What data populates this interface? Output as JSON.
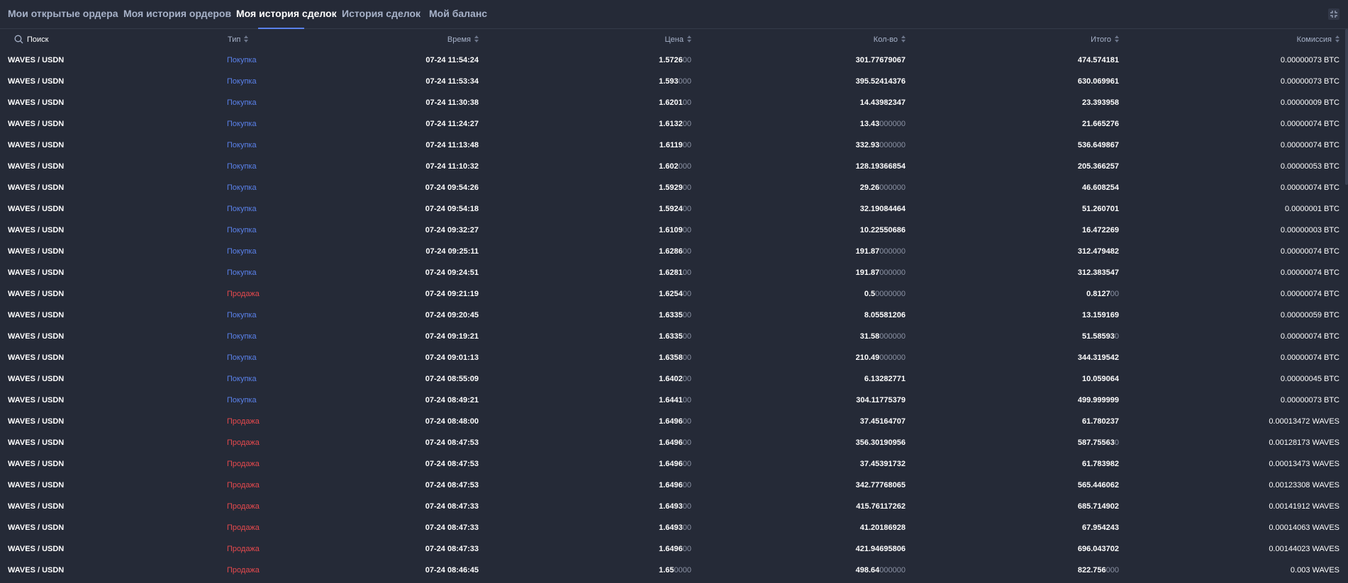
{
  "tabs": [
    {
      "label": "Мои открытые ордера"
    },
    {
      "label": "Моя история ордеров"
    },
    {
      "label": "Моя история сделок"
    },
    {
      "label": "История сделок"
    },
    {
      "label": "Мой баланс"
    }
  ],
  "active_tab": "Моя история сделок",
  "search": {
    "placeholder": "Поиск",
    "value": ""
  },
  "columns": {
    "type": "Тип",
    "time": "Время",
    "price": "Цена",
    "qty": "Кол-во",
    "total": "Итого",
    "fee": "Комиссия"
  },
  "colors": {
    "background": "#252a37",
    "buy": "#5a81ea",
    "sell": "#e5494d",
    "muted_digits": "#8c93a5",
    "tab_inactive": "#a7b2c9"
  },
  "rows": [
    {
      "pair": "WAVES / USDN",
      "type": "Покупка",
      "side": "buy",
      "time": "07-24 11:54:24",
      "price": "1.5726",
      "price_pad": "00",
      "qty": "301.77679067",
      "qty_pad": "",
      "total": "474.574181",
      "total_pad": "",
      "fee": "0.00000073 BTC"
    },
    {
      "pair": "WAVES / USDN",
      "type": "Покупка",
      "side": "buy",
      "time": "07-24 11:53:34",
      "price": "1.593",
      "price_pad": "000",
      "qty": "395.52414376",
      "qty_pad": "",
      "total": "630.069961",
      "total_pad": "",
      "fee": "0.00000073 BTC"
    },
    {
      "pair": "WAVES / USDN",
      "type": "Покупка",
      "side": "buy",
      "time": "07-24 11:30:38",
      "price": "1.6201",
      "price_pad": "00",
      "qty": "14.43982347",
      "qty_pad": "",
      "total": "23.393958",
      "total_pad": "",
      "fee": "0.00000009 BTC"
    },
    {
      "pair": "WAVES / USDN",
      "type": "Покупка",
      "side": "buy",
      "time": "07-24 11:24:27",
      "price": "1.6132",
      "price_pad": "00",
      "qty": "13.43",
      "qty_pad": "000000",
      "total": "21.665276",
      "total_pad": "",
      "fee": "0.00000074 BTC"
    },
    {
      "pair": "WAVES / USDN",
      "type": "Покупка",
      "side": "buy",
      "time": "07-24 11:13:48",
      "price": "1.6119",
      "price_pad": "00",
      "qty": "332.93",
      "qty_pad": "000000",
      "total": "536.649867",
      "total_pad": "",
      "fee": "0.00000074 BTC"
    },
    {
      "pair": "WAVES / USDN",
      "type": "Покупка",
      "side": "buy",
      "time": "07-24 11:10:32",
      "price": "1.602",
      "price_pad": "000",
      "qty": "128.19366854",
      "qty_pad": "",
      "total": "205.366257",
      "total_pad": "",
      "fee": "0.00000053 BTC"
    },
    {
      "pair": "WAVES / USDN",
      "type": "Покупка",
      "side": "buy",
      "time": "07-24 09:54:26",
      "price": "1.5929",
      "price_pad": "00",
      "qty": "29.26",
      "qty_pad": "000000",
      "total": "46.608254",
      "total_pad": "",
      "fee": "0.00000074 BTC"
    },
    {
      "pair": "WAVES / USDN",
      "type": "Покупка",
      "side": "buy",
      "time": "07-24 09:54:18",
      "price": "1.5924",
      "price_pad": "00",
      "qty": "32.19084464",
      "qty_pad": "",
      "total": "51.260701",
      "total_pad": "",
      "fee": "0.0000001 BTC"
    },
    {
      "pair": "WAVES / USDN",
      "type": "Покупка",
      "side": "buy",
      "time": "07-24 09:32:27",
      "price": "1.6109",
      "price_pad": "00",
      "qty": "10.22550686",
      "qty_pad": "",
      "total": "16.472269",
      "total_pad": "",
      "fee": "0.00000003 BTC"
    },
    {
      "pair": "WAVES / USDN",
      "type": "Покупка",
      "side": "buy",
      "time": "07-24 09:25:11",
      "price": "1.6286",
      "price_pad": "00",
      "qty": "191.87",
      "qty_pad": "000000",
      "total": "312.479482",
      "total_pad": "",
      "fee": "0.00000074 BTC"
    },
    {
      "pair": "WAVES / USDN",
      "type": "Покупка",
      "side": "buy",
      "time": "07-24 09:24:51",
      "price": "1.6281",
      "price_pad": "00",
      "qty": "191.87",
      "qty_pad": "000000",
      "total": "312.383547",
      "total_pad": "",
      "fee": "0.00000074 BTC"
    },
    {
      "pair": "WAVES / USDN",
      "type": "Продажа",
      "side": "sell",
      "time": "07-24 09:21:19",
      "price": "1.6254",
      "price_pad": "00",
      "qty": "0.5",
      "qty_pad": "0000000",
      "total": "0.8127",
      "total_pad": "00",
      "fee": "0.00000074 BTC"
    },
    {
      "pair": "WAVES / USDN",
      "type": "Покупка",
      "side": "buy",
      "time": "07-24 09:20:45",
      "price": "1.6335",
      "price_pad": "00",
      "qty": "8.05581206",
      "qty_pad": "",
      "total": "13.159169",
      "total_pad": "",
      "fee": "0.00000059 BTC"
    },
    {
      "pair": "WAVES / USDN",
      "type": "Покупка",
      "side": "buy",
      "time": "07-24 09:19:21",
      "price": "1.6335",
      "price_pad": "00",
      "qty": "31.58",
      "qty_pad": "000000",
      "total": "51.58593",
      "total_pad": "0",
      "fee": "0.00000074 BTC"
    },
    {
      "pair": "WAVES / USDN",
      "type": "Покупка",
      "side": "buy",
      "time": "07-24 09:01:13",
      "price": "1.6358",
      "price_pad": "00",
      "qty": "210.49",
      "qty_pad": "000000",
      "total": "344.319542",
      "total_pad": "",
      "fee": "0.00000074 BTC"
    },
    {
      "pair": "WAVES / USDN",
      "type": "Покупка",
      "side": "buy",
      "time": "07-24 08:55:09",
      "price": "1.6402",
      "price_pad": "00",
      "qty": "6.13282771",
      "qty_pad": "",
      "total": "10.059064",
      "total_pad": "",
      "fee": "0.00000045 BTC"
    },
    {
      "pair": "WAVES / USDN",
      "type": "Покупка",
      "side": "buy",
      "time": "07-24 08:49:21",
      "price": "1.6441",
      "price_pad": "00",
      "qty": "304.11775379",
      "qty_pad": "",
      "total": "499.999999",
      "total_pad": "",
      "fee": "0.00000073 BTC"
    },
    {
      "pair": "WAVES / USDN",
      "type": "Продажа",
      "side": "sell",
      "time": "07-24 08:48:00",
      "price": "1.6496",
      "price_pad": "00",
      "qty": "37.45164707",
      "qty_pad": "",
      "total": "61.780237",
      "total_pad": "",
      "fee": "0.00013472 WAVES"
    },
    {
      "pair": "WAVES / USDN",
      "type": "Продажа",
      "side": "sell",
      "time": "07-24 08:47:53",
      "price": "1.6496",
      "price_pad": "00",
      "qty": "356.30190956",
      "qty_pad": "",
      "total": "587.75563",
      "total_pad": "0",
      "fee": "0.00128173 WAVES"
    },
    {
      "pair": "WAVES / USDN",
      "type": "Продажа",
      "side": "sell",
      "time": "07-24 08:47:53",
      "price": "1.6496",
      "price_pad": "00",
      "qty": "37.45391732",
      "qty_pad": "",
      "total": "61.783982",
      "total_pad": "",
      "fee": "0.00013473 WAVES"
    },
    {
      "pair": "WAVES / USDN",
      "type": "Продажа",
      "side": "sell",
      "time": "07-24 08:47:53",
      "price": "1.6496",
      "price_pad": "00",
      "qty": "342.77768065",
      "qty_pad": "",
      "total": "565.446062",
      "total_pad": "",
      "fee": "0.00123308 WAVES"
    },
    {
      "pair": "WAVES / USDN",
      "type": "Продажа",
      "side": "sell",
      "time": "07-24 08:47:33",
      "price": "1.6493",
      "price_pad": "00",
      "qty": "415.76117262",
      "qty_pad": "",
      "total": "685.714902",
      "total_pad": "",
      "fee": "0.00141912 WAVES"
    },
    {
      "pair": "WAVES / USDN",
      "type": "Продажа",
      "side": "sell",
      "time": "07-24 08:47:33",
      "price": "1.6493",
      "price_pad": "00",
      "qty": "41.20186928",
      "qty_pad": "",
      "total": "67.954243",
      "total_pad": "",
      "fee": "0.00014063 WAVES"
    },
    {
      "pair": "WAVES / USDN",
      "type": "Продажа",
      "side": "sell",
      "time": "07-24 08:47:33",
      "price": "1.6496",
      "price_pad": "00",
      "qty": "421.94695806",
      "qty_pad": "",
      "total": "696.043702",
      "total_pad": "",
      "fee": "0.00144023 WAVES"
    },
    {
      "pair": "WAVES / USDN",
      "type": "Продажа",
      "side": "sell",
      "time": "07-24 08:46:45",
      "price": "1.65",
      "price_pad": "0000",
      "qty": "498.64",
      "qty_pad": "000000",
      "total": "822.756",
      "total_pad": "000",
      "fee": "0.003 WAVES"
    }
  ]
}
